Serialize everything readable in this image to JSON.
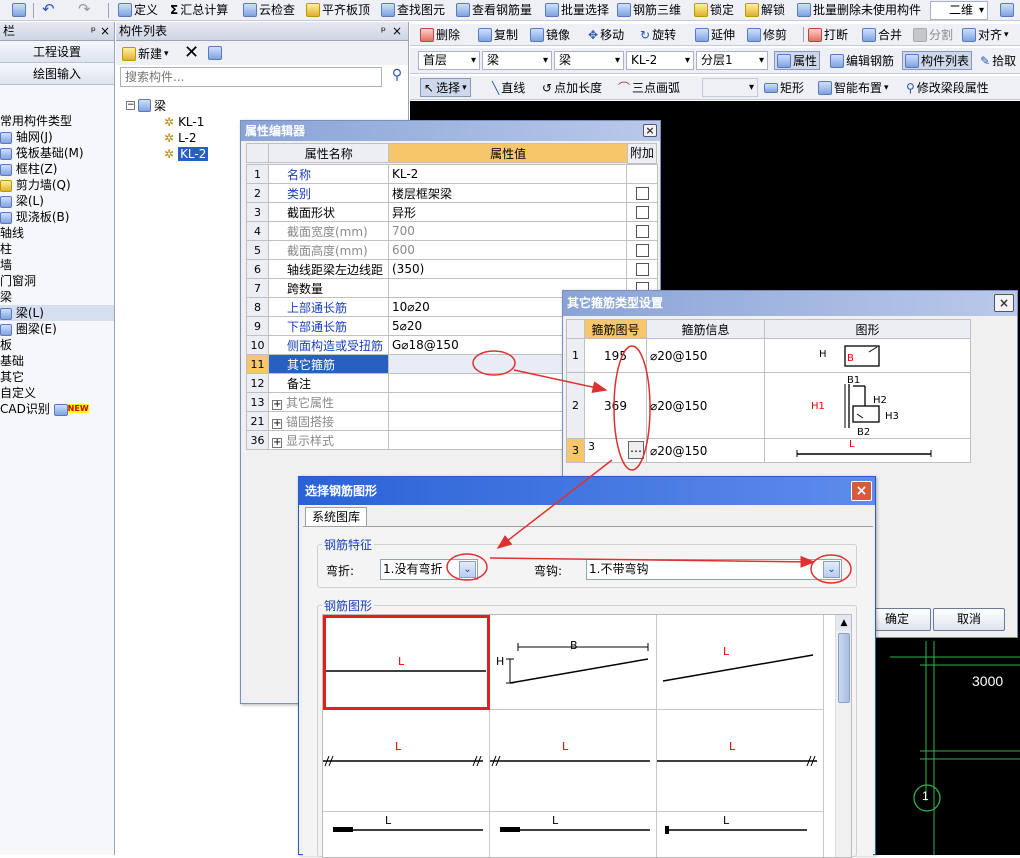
{
  "toolbar1": {
    "items": [
      "定义",
      "汇总计算",
      "云检查",
      "平齐板顶",
      "查找图元",
      "查看钢筋量",
      "批量选择",
      "钢筋三维",
      "锁定",
      "解锁",
      "批量删除未使用构件",
      "二维"
    ]
  },
  "left_panel": {
    "title": "栏",
    "btn_engineering": "工程设置",
    "btn_drawing": "绘图输入",
    "tree": [
      "常用构件类型",
      "轴网(J)",
      "筏板基础(M)",
      "框柱(Z)",
      "剪力墙(Q)",
      "梁(L)",
      "现浇板(B)",
      "轴线",
      "柱",
      "墙",
      "门窗洞",
      "梁",
      "梁(L)",
      "圈梁(E)",
      "板",
      "基础",
      "其它",
      "自定义",
      "CAD识别"
    ],
    "new_badge": "NEW"
  },
  "component_list": {
    "title": "构件列表",
    "new_label": "新建",
    "search_placeholder": "搜索构件...",
    "root": "梁",
    "items": [
      "KL-1",
      "L-2",
      "KL-2"
    ]
  },
  "toolbar2": {
    "items": [
      "删除",
      "复制",
      "镜像",
      "移动",
      "旋转",
      "延伸",
      "修剪",
      "打断",
      "合并",
      "分割",
      "对齐"
    ]
  },
  "toolbar3": {
    "combos": [
      "首层",
      "梁",
      "梁",
      "KL-2",
      "分层1"
    ],
    "items": [
      "属性",
      "编辑钢筋",
      "构件列表",
      "拾取"
    ]
  },
  "toolbar4": {
    "items": [
      "选择",
      "直线",
      "点加长度",
      "三点画弧",
      "矩形",
      "智能布置",
      "修改梁段属性"
    ]
  },
  "canvas": {
    "dim_label": "3000",
    "axis_label": "1"
  },
  "property_editor": {
    "title": "属性编辑器",
    "col_name": "属性名称",
    "col_value": "属性值",
    "col_extra": "附加",
    "rows": [
      {
        "no": "1",
        "name": "名称",
        "value": "KL-2"
      },
      {
        "no": "2",
        "name": "类别",
        "value": "楼层框架梁"
      },
      {
        "no": "3",
        "name": "截面形状",
        "value": "异形"
      },
      {
        "no": "4",
        "name": "截面宽度(mm)",
        "value": "700"
      },
      {
        "no": "5",
        "name": "截面高度(mm)",
        "value": "600"
      },
      {
        "no": "6",
        "name": "轴线距梁左边线距",
        "value": "(350)"
      },
      {
        "no": "7",
        "name": "跨数量",
        "value": ""
      },
      {
        "no": "8",
        "name": "上部通长筋",
        "value": "10⌀20"
      },
      {
        "no": "9",
        "name": "下部通长筋",
        "value": "5⌀20"
      },
      {
        "no": "10",
        "name": "侧面构造或受扭筋",
        "value": "G⌀18@150"
      },
      {
        "no": "11",
        "name": "其它箍筋",
        "value": ""
      },
      {
        "no": "12",
        "name": "备注",
        "value": ""
      },
      {
        "no": "13",
        "name": "其它属性",
        "value": ""
      },
      {
        "no": "21",
        "name": "锚固搭接",
        "value": ""
      },
      {
        "no": "36",
        "name": "显示样式",
        "value": ""
      }
    ]
  },
  "stirrup_dialog": {
    "title": "其它箍筋类型设置",
    "col_no": "箍筋图号",
    "col_info": "箍筋信息",
    "col_shape": "图形",
    "rows": [
      {
        "no": "1",
        "code": "195",
        "info": "⌀20@150"
      },
      {
        "no": "2",
        "code": "369",
        "info": "⌀20@150"
      },
      {
        "no": "3",
        "code": "3",
        "info": "⌀20@150"
      }
    ],
    "shape1": {
      "h": "H",
      "b": "B"
    },
    "shape2": {
      "b1": "B1",
      "h1": "H1",
      "h2": "H2",
      "h3": "H3",
      "b2": "B2"
    },
    "shape3": {
      "l": "L"
    },
    "ok": "确定",
    "cancel": "取消"
  },
  "rebar_dialog": {
    "title": "选择钢筋图形",
    "tab": "系统图库",
    "group_feature": "钢筋特征",
    "bend_label": "弯折:",
    "bend_value": "1.没有弯折",
    "hook_label": "弯钩:",
    "hook_value": "1.不带弯钩",
    "group_shape": "钢筋图形",
    "shape_labels": {
      "l": "L",
      "b": "B",
      "h": "H"
    }
  }
}
